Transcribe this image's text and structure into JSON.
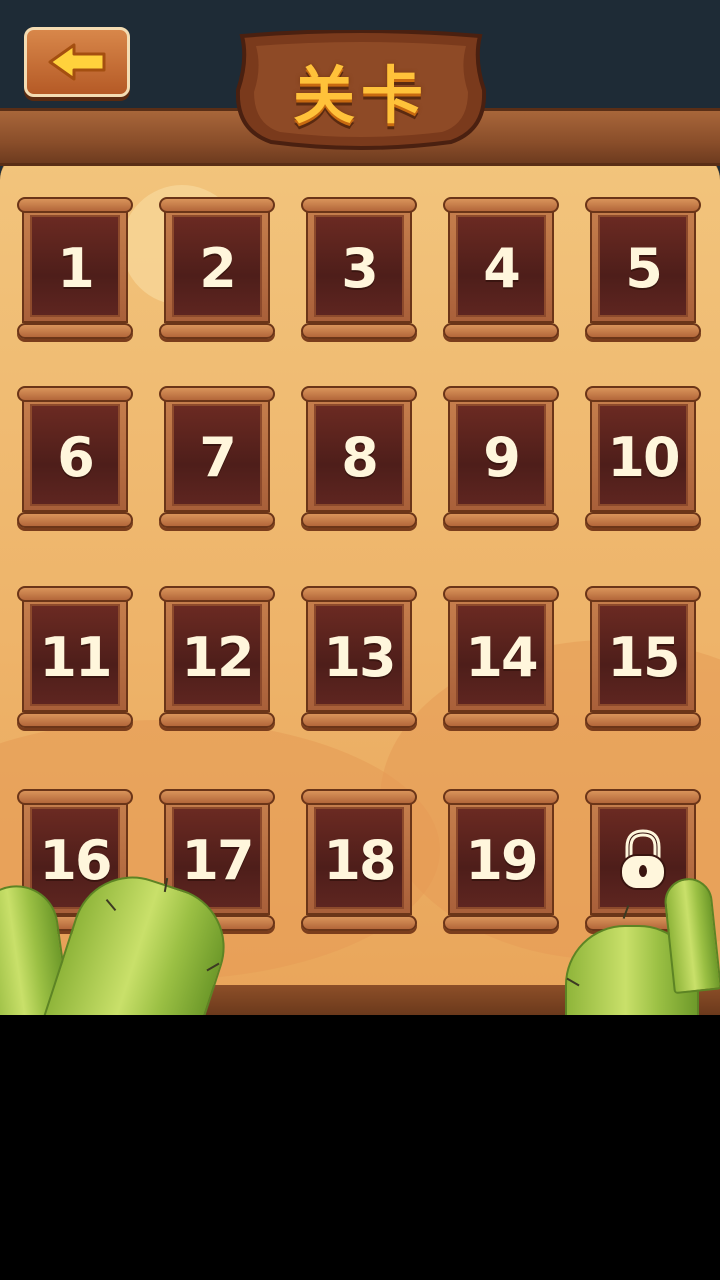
{
  "header": {
    "title": "关卡",
    "back_icon": "arrow-left-icon"
  },
  "levels": [
    {
      "label": "1"
    },
    {
      "label": "2"
    },
    {
      "label": "3"
    },
    {
      "label": "4"
    },
    {
      "label": "5"
    },
    {
      "label": "6"
    },
    {
      "label": "7"
    },
    {
      "label": "8"
    },
    {
      "label": "9"
    },
    {
      "label": "10"
    },
    {
      "label": "11"
    },
    {
      "label": "12"
    },
    {
      "label": "13"
    },
    {
      "label": "14"
    },
    {
      "label": "15"
    },
    {
      "label": "16"
    },
    {
      "label": "17"
    },
    {
      "label": "18"
    },
    {
      "label": "19"
    },
    {
      "label": "",
      "locked": true,
      "icon": "lock-icon"
    }
  ],
  "colors": {
    "title": "#ffc23a",
    "tile_face": "#5a2420",
    "number": "#fff6dc",
    "sand": "#efb86e"
  }
}
